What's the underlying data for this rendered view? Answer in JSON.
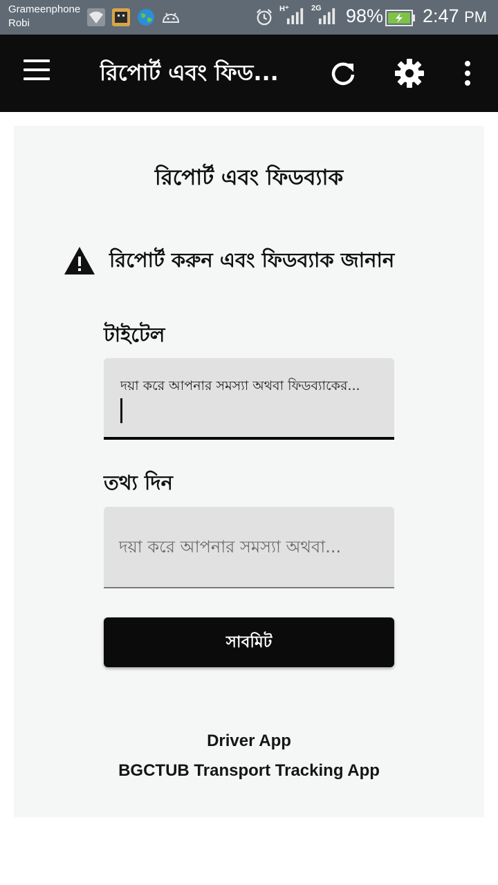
{
  "status_bar": {
    "carrier_1": "Grameenphone",
    "carrier_2": "Robi",
    "net_1": "H⁺",
    "net_2": "2G",
    "battery": "98%",
    "time": "2:47",
    "ampm": "PM",
    "icons": [
      "wifi-icon",
      "app-notification-icon",
      "globe-icon",
      "android-icon",
      "alarm-icon",
      "signal-icon",
      "battery-charging-icon"
    ]
  },
  "app_bar": {
    "title": "রিপোর্ট এবং ফিড...",
    "icons": [
      "menu-icon",
      "refresh-icon",
      "gear-icon",
      "more-vert-icon"
    ]
  },
  "main": {
    "title": "রিপোর্ট এবং ফিডব্যাক",
    "notice": "রিপোর্ট করুন এবং ফিডব্যাক জানান",
    "title_field": {
      "label": "টাইটেল",
      "value": "দয়া করে আপনার সমস্যা অথবা ফিডব্যাকের..."
    },
    "info_field": {
      "label": "তথ্য দিন",
      "placeholder": "দয়া করে আপনার সমস্যা অথবা..."
    },
    "submit_label": "সাবমিট"
  },
  "footer": {
    "line_1": "Driver App",
    "line_2": "BGCTUB Transport Tracking App"
  }
}
